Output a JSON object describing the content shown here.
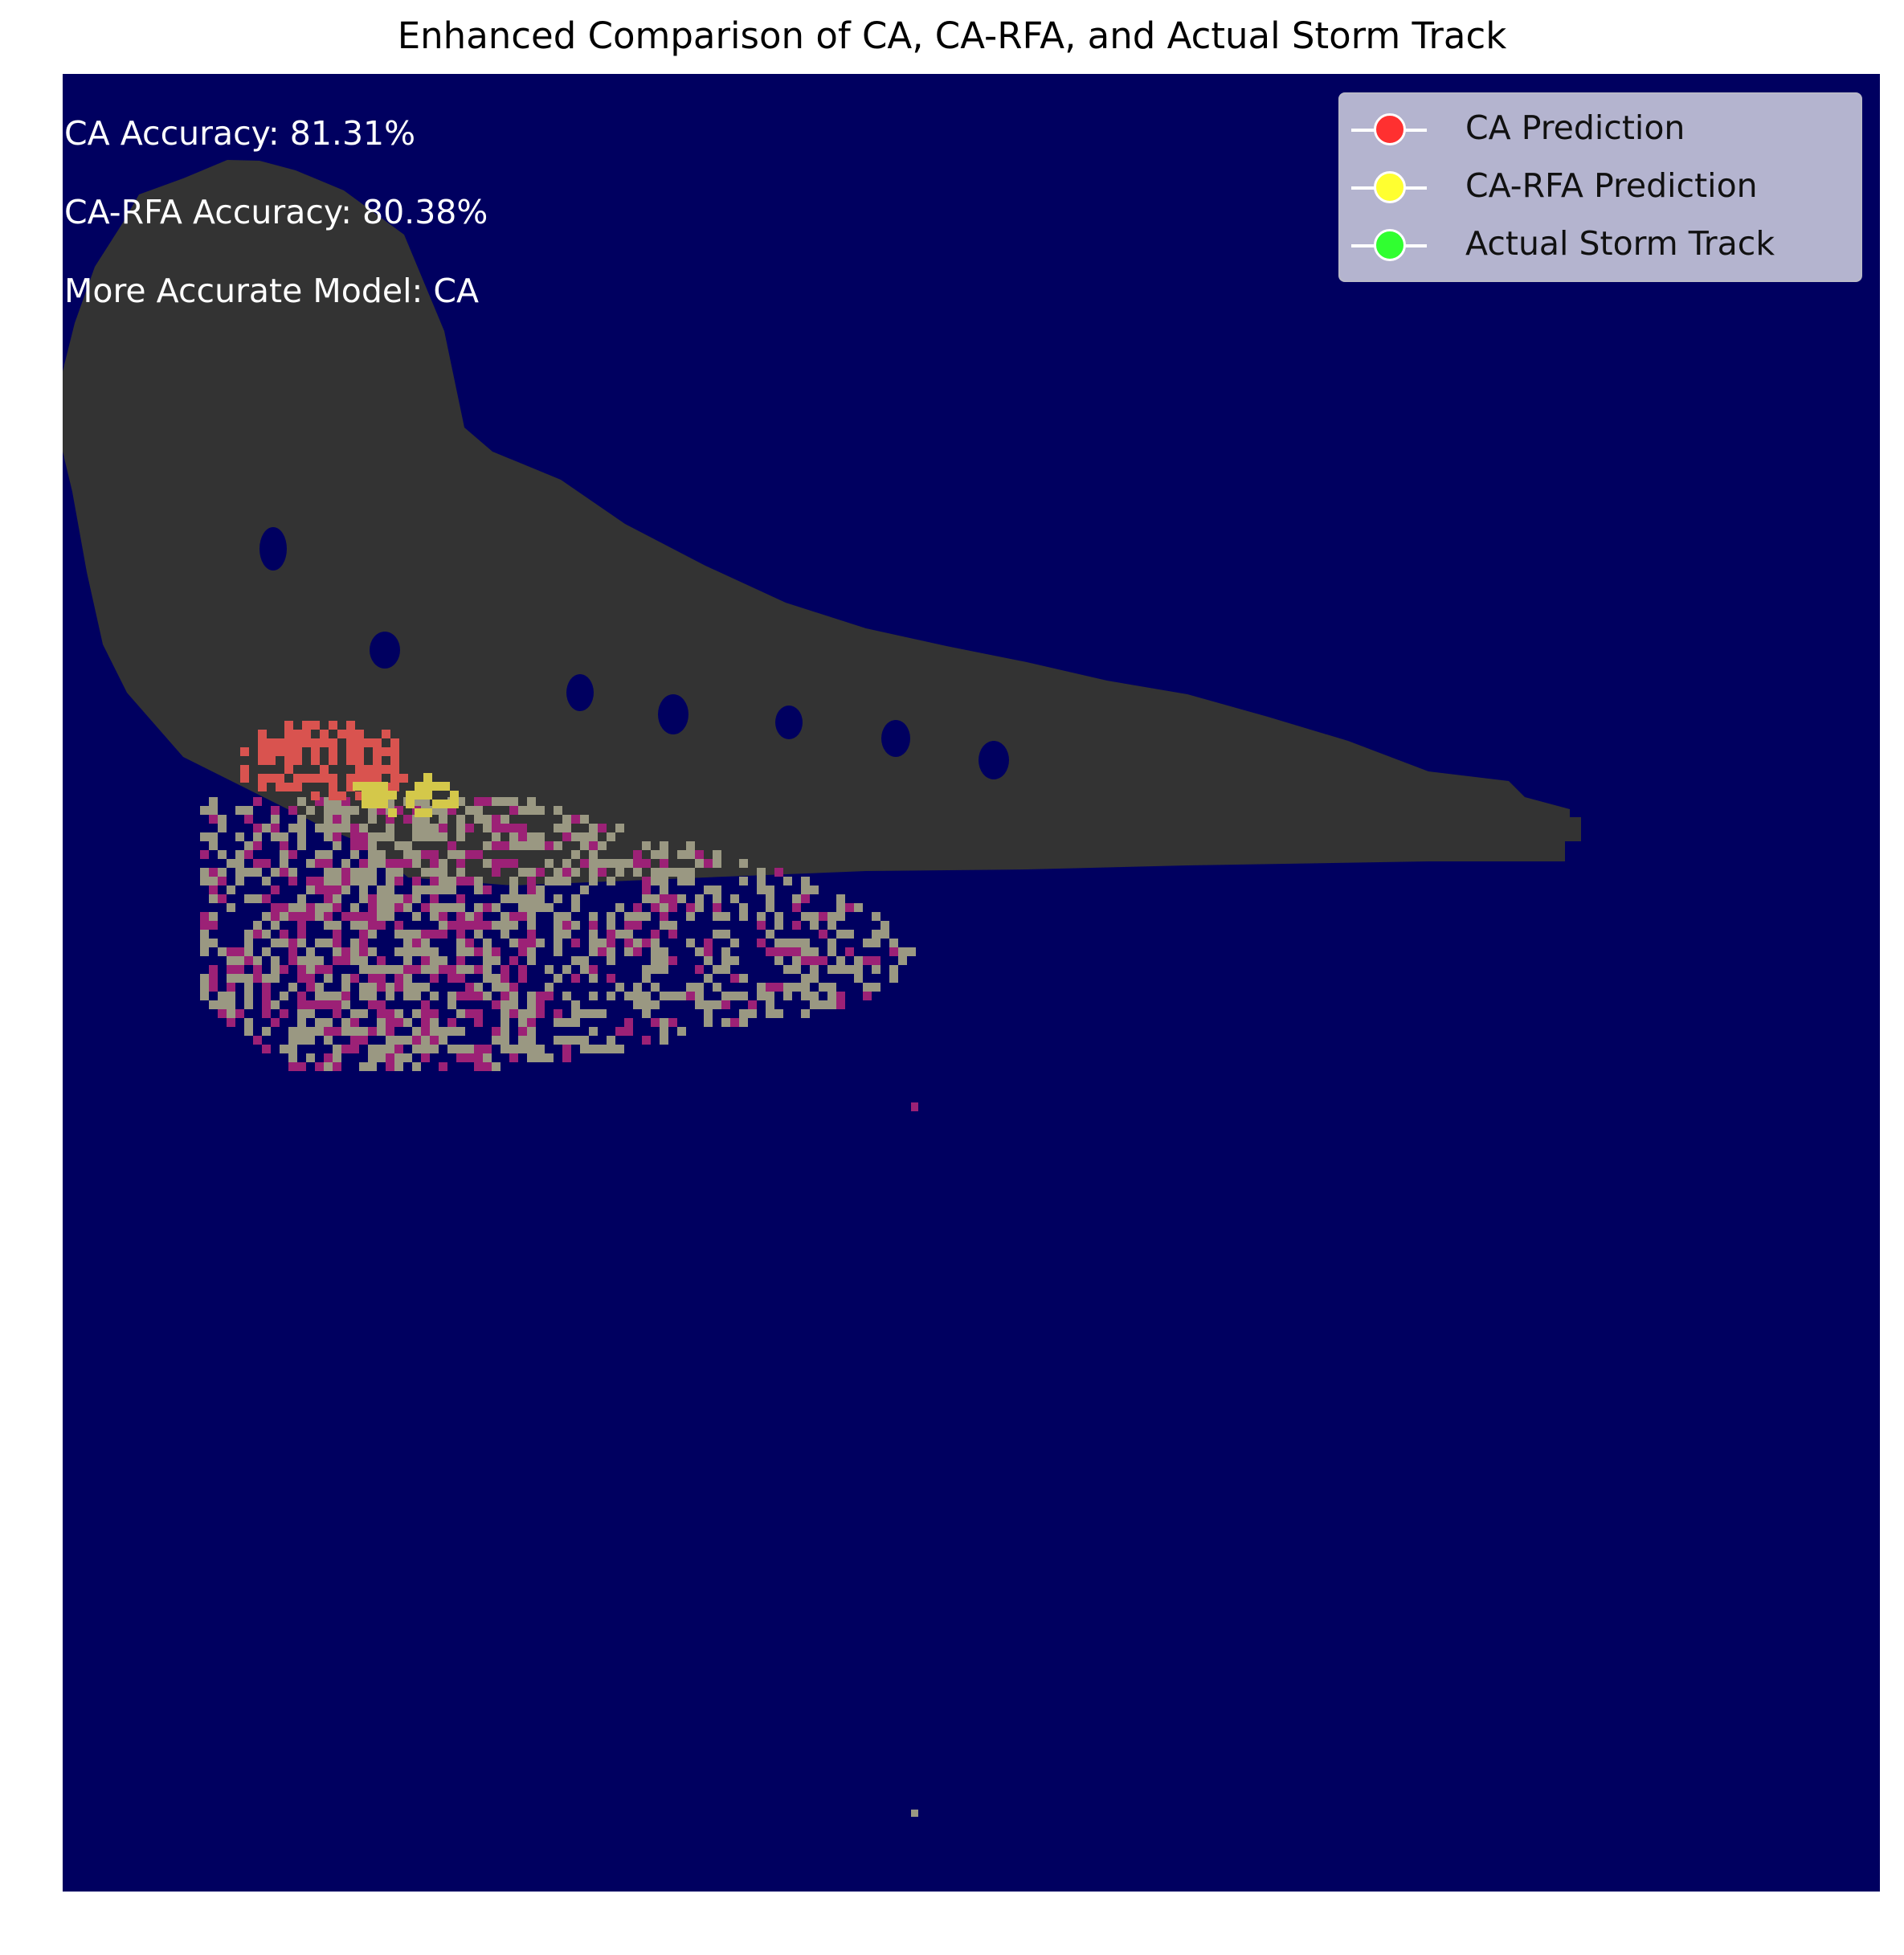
{
  "chart_data": {
    "type": "heatmap",
    "title": "Enhanced Comparison of CA, CA-RFA, and Actual Storm Track",
    "grid": false,
    "axes_visible": false,
    "legend_position": "top-right",
    "background_color": "#000060",
    "annotations": [
      "CA Accuracy: 81.31%",
      "CA-RFA Accuracy: 80.38%",
      "More Accurate Model: CA"
    ],
    "legend": [
      {
        "label": "CA Prediction",
        "color": "#ff3030"
      },
      {
        "label": "CA-RFA Prediction",
        "color": "#ffff30"
      },
      {
        "label": "Actual Storm Track",
        "color": "#30ff30"
      }
    ],
    "region_colors": {
      "storm_body": "#333333",
      "ca_overlap": "#d9534f",
      "ca_rfa_overlap": "#d4c84a",
      "track_cells": "#9a9882",
      "track_ca_cells": "#9c2176"
    }
  }
}
